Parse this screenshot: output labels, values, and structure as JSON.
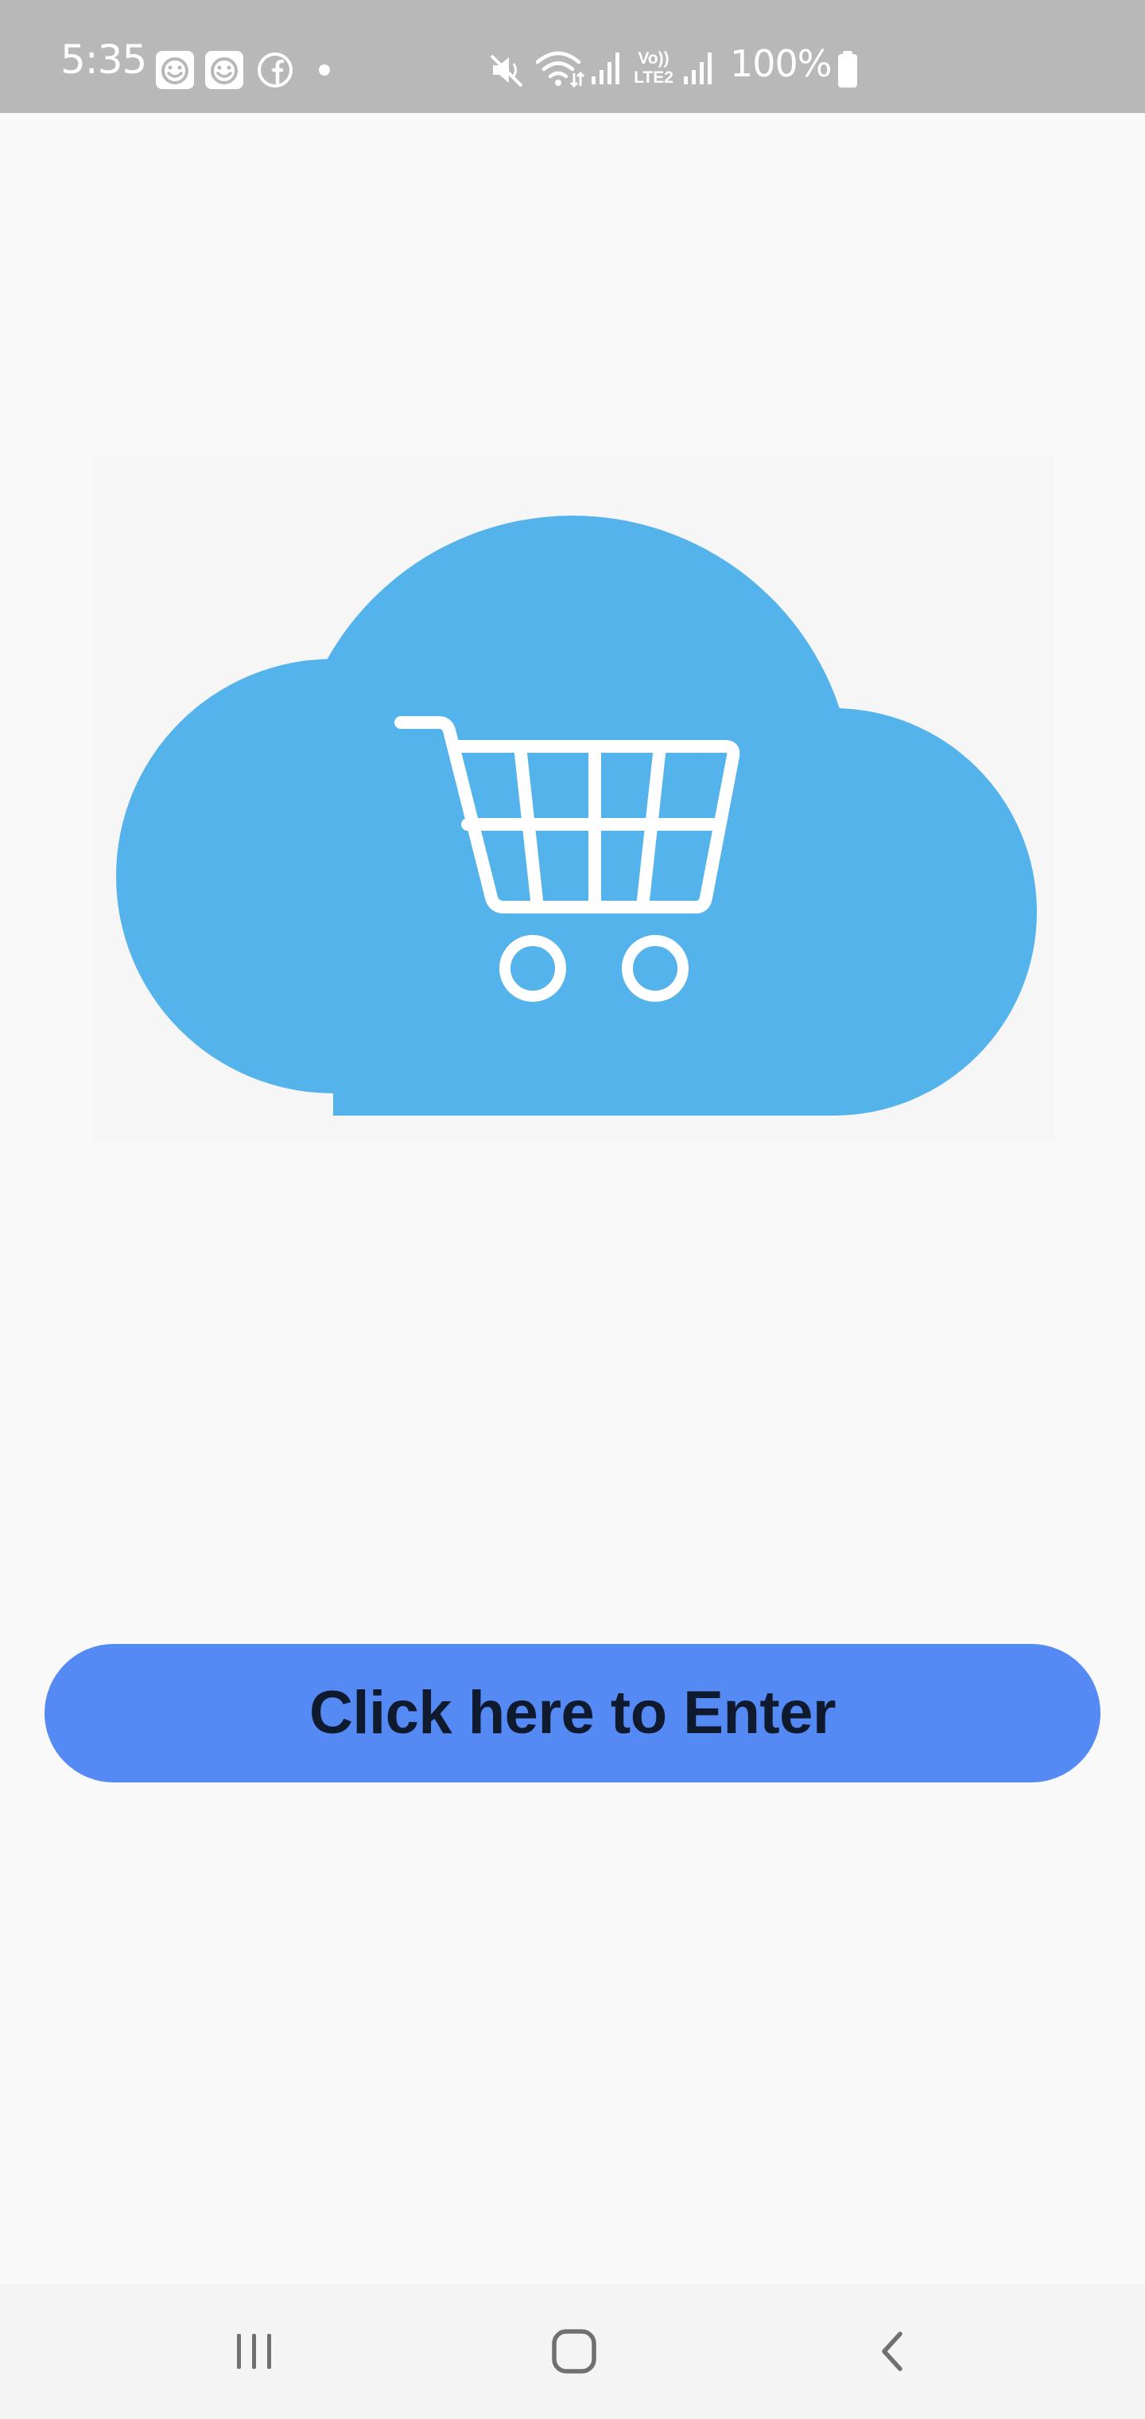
{
  "status_bar": {
    "time": "5:35",
    "battery_text": "100%",
    "icons": [
      "smiley-notification-icon",
      "smiley-notification-icon",
      "facebook-icon",
      "dot-icon",
      "mute-icon",
      "wifi-icon",
      "signal-icon",
      "volte-lte2-icon",
      "signal-icon",
      "battery-icon"
    ],
    "volte_label_top": "Vo))",
    "volte_label_bottom": "LTE2"
  },
  "hero": {
    "icon": "shopping-cart-cloud-icon",
    "cloud_color": "#54b3ea",
    "cart_color": "#ffffff"
  },
  "enter_button": {
    "label": "Click here to Enter",
    "color": "#5589f4"
  },
  "nav_bar": {
    "recents_icon": "recents-icon",
    "home_icon": "home-icon",
    "back_icon": "back-icon"
  }
}
